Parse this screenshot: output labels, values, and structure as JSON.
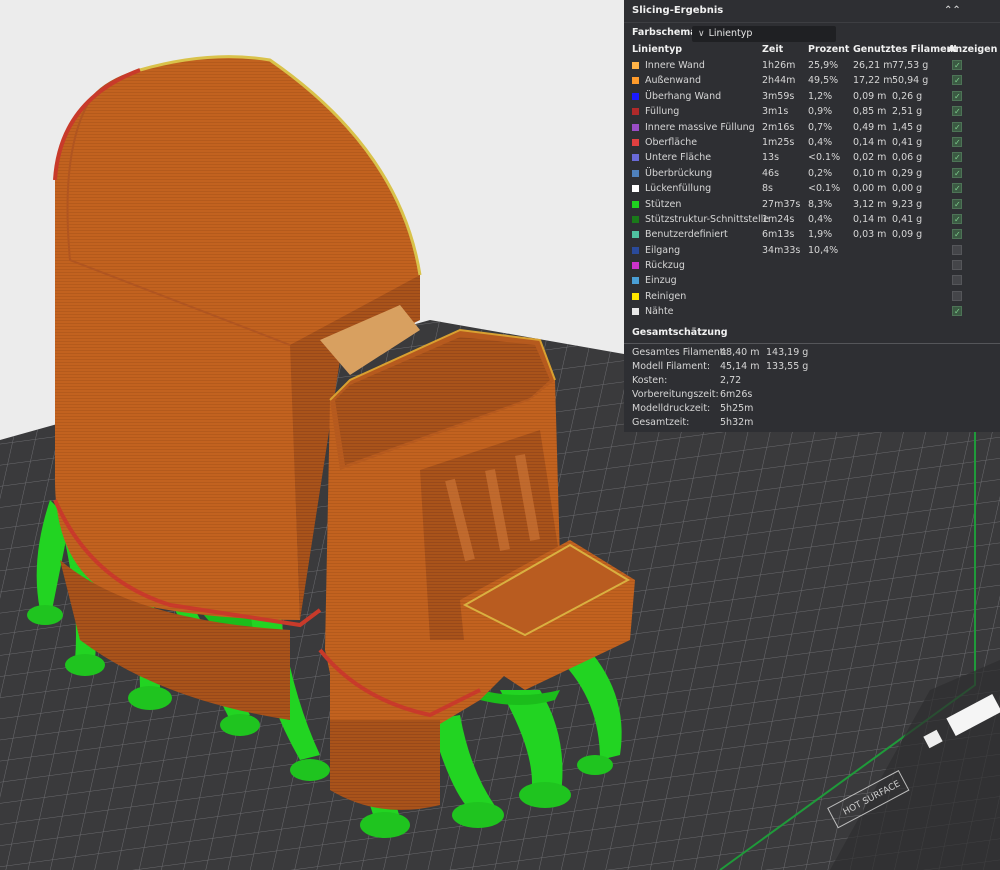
{
  "panel": {
    "title": "Slicing-Ergebnis",
    "color_scheme_label": "Farbschema",
    "color_scheme_value": "Linientyp",
    "columns": [
      "Linientyp",
      "Zeit",
      "Prozent",
      "Genutztes Filament",
      "Anzeigen"
    ],
    "rows": [
      {
        "name": "Innere Wand",
        "color": "#ffb347",
        "time": "1h26m",
        "percent": "25,9%",
        "length": "26,21 m",
        "weight": "77,53 g",
        "shown": true
      },
      {
        "name": "Außenwand",
        "color": "#ff9b2b",
        "time": "2h44m",
        "percent": "49,5%",
        "length": "17,22 m",
        "weight": "50,94 g",
        "shown": true
      },
      {
        "name": "Überhang Wand",
        "color": "#1a1aff",
        "time": "3m59s",
        "percent": "1,2%",
        "length": "0,09 m",
        "weight": "0,26 g",
        "shown": true
      },
      {
        "name": "Füllung",
        "color": "#b02a2a",
        "time": "3m1s",
        "percent": "0,9%",
        "length": "0,85 m",
        "weight": "2,51 g",
        "shown": true
      },
      {
        "name": "Innere massive Füllung",
        "color": "#9a4dc6",
        "time": "2m16s",
        "percent": "0,7%",
        "length": "0,49 m",
        "weight": "1,45 g",
        "shown": true
      },
      {
        "name": "Oberfläche",
        "color": "#e04040",
        "time": "1m25s",
        "percent": "0,4%",
        "length": "0,14 m",
        "weight": "0,41 g",
        "shown": true
      },
      {
        "name": "Untere Fläche",
        "color": "#6a6ad8",
        "time": "13s",
        "percent": "<0.1%",
        "length": "0,02 m",
        "weight": "0,06 g",
        "shown": true
      },
      {
        "name": "Überbrückung",
        "color": "#4f81bd",
        "time": "46s",
        "percent": "0,2%",
        "length": "0,10 m",
        "weight": "0,29 g",
        "shown": true
      },
      {
        "name": "Lückenfüllung",
        "color": "#ffffff",
        "time": "8s",
        "percent": "<0.1%",
        "length": "0,00 m",
        "weight": "0,00 g",
        "shown": true
      },
      {
        "name": "Stützen",
        "color": "#1fd11f",
        "time": "27m37s",
        "percent": "8,3%",
        "length": "3,12 m",
        "weight": "9,23 g",
        "shown": true
      },
      {
        "name": "Stützstruktur-Schnittstelle",
        "color": "#1a7a1a",
        "time": "1m24s",
        "percent": "0,4%",
        "length": "0,14 m",
        "weight": "0,41 g",
        "shown": true
      },
      {
        "name": "Benutzerdefiniert",
        "color": "#4fc2a0",
        "time": "6m13s",
        "percent": "1,9%",
        "length": "0,03 m",
        "weight": "0,09 g",
        "shown": true
      },
      {
        "name": "Eilgang",
        "color": "#2a4a9a",
        "time": "34m33s",
        "percent": "10,4%",
        "length": "",
        "weight": "",
        "shown": false
      },
      {
        "name": "Rückzug",
        "color": "#cc33cc",
        "time": "",
        "percent": "",
        "length": "",
        "weight": "",
        "shown": false
      },
      {
        "name": "Einzug",
        "color": "#4a9fd6",
        "time": "",
        "percent": "",
        "length": "",
        "weight": "",
        "shown": false
      },
      {
        "name": "Reinigen",
        "color": "#ffe600",
        "time": "",
        "percent": "",
        "length": "",
        "weight": "",
        "shown": false
      },
      {
        "name": "Nähte",
        "color": "#e8e8e8",
        "time": "",
        "percent": "",
        "length": "",
        "weight": "",
        "shown": true
      }
    ],
    "summary_title": "Gesamtschätzung",
    "summary": [
      {
        "label": "Gesamtes Filament:",
        "v1": "48,40 m",
        "v2": "143,19 g"
      },
      {
        "label": "Modell Filament:",
        "v1": "45,14 m",
        "v2": "133,55 g"
      },
      {
        "label": "Kosten:",
        "v1": "2,72",
        "v2": ""
      },
      {
        "label": "Vorbereitungszeit:",
        "v1": "6m26s",
        "v2": ""
      },
      {
        "label": "Modelldruckzeit:",
        "v1": "5h25m",
        "v2": ""
      },
      {
        "label": "Gesamtzeit:",
        "v1": "5h32m",
        "v2": ""
      }
    ]
  },
  "plate": {
    "label": "HOT SURFACE"
  },
  "colors": {
    "model": "#c2621f",
    "model_dark": "#a04f16",
    "model_light": "#d67a33",
    "support": "#22d422",
    "support_dark": "#17a317",
    "plate": "#3a3a3c",
    "grid": "#6c6c70",
    "background": "#ececec"
  }
}
